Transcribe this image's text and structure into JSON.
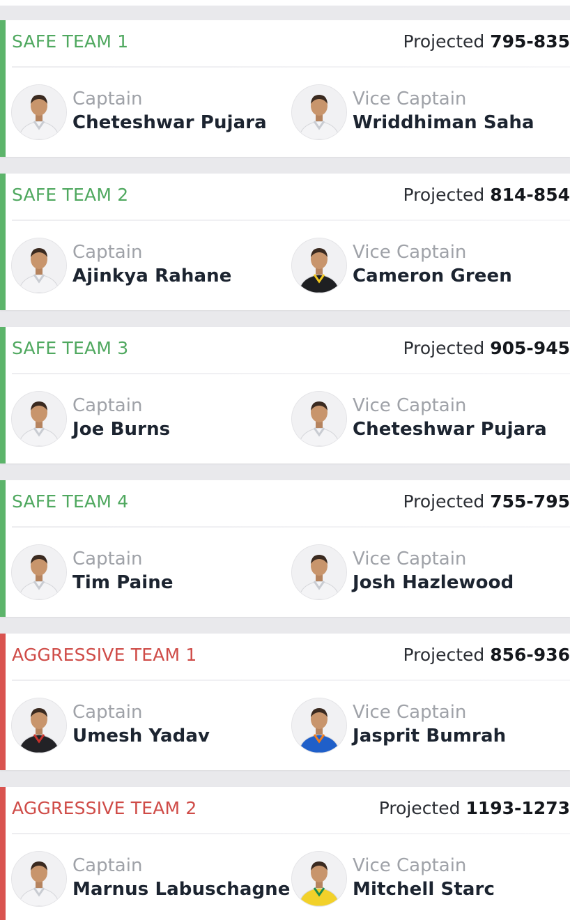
{
  "projected_label": "Projected",
  "captain_label": "Captain",
  "vice_captain_label": "Vice Captain",
  "colors": {
    "safe": "#5cb46a",
    "aggressive": "#d9534f"
  },
  "teams": [
    {
      "name": "SAFE TEAM 1",
      "style": "safe",
      "projected": "795-835",
      "captain": {
        "name": "Cheteshwar Pujara",
        "jersey": "white"
      },
      "vice_captain": {
        "name": "Wriddhiman Saha",
        "jersey": "white"
      }
    },
    {
      "name": "SAFE TEAM 2",
      "style": "safe",
      "projected": "814-854",
      "captain": {
        "name": "Ajinkya Rahane",
        "jersey": "white"
      },
      "vice_captain": {
        "name": "Cameron Green",
        "jersey": "black-yellow"
      }
    },
    {
      "name": "SAFE TEAM 3",
      "style": "safe",
      "projected": "905-945",
      "captain": {
        "name": "Joe Burns",
        "jersey": "white"
      },
      "vice_captain": {
        "name": "Cheteshwar Pujara",
        "jersey": "white"
      }
    },
    {
      "name": "SAFE TEAM 4",
      "style": "safe",
      "projected": "755-795",
      "captain": {
        "name": "Tim Paine",
        "jersey": "white"
      },
      "vice_captain": {
        "name": "Josh Hazlewood",
        "jersey": "white"
      }
    },
    {
      "name": "AGGRESSIVE TEAM 1",
      "style": "aggressive",
      "projected": "856-936",
      "captain": {
        "name": "Umesh Yadav",
        "jersey": "black-red"
      },
      "vice_captain": {
        "name": "Jasprit Bumrah",
        "jersey": "blue"
      }
    },
    {
      "name": "AGGRESSIVE TEAM 2",
      "style": "aggressive",
      "projected": "1193-1273",
      "captain": {
        "name": "Marnus Labuschagne",
        "jersey": "white"
      },
      "vice_captain": {
        "name": "Mitchell Starc",
        "jersey": "yellow-green"
      }
    }
  ]
}
